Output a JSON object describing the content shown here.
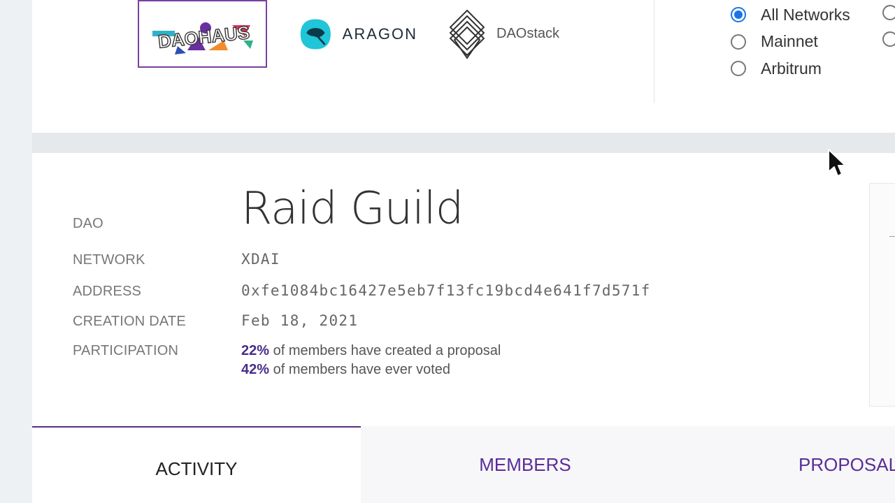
{
  "platforms": [
    {
      "name": "daohaus",
      "label": "DAOHAUS",
      "selected": true
    },
    {
      "name": "aragon",
      "label": "ARAGON",
      "selected": false
    },
    {
      "name": "daostack",
      "label": "DAOstack",
      "selected": false
    }
  ],
  "networks": {
    "options": [
      {
        "label": "All Networks",
        "checked": true
      },
      {
        "label": "Mainnet",
        "checked": false
      },
      {
        "label": "Arbitrum",
        "checked": false
      }
    ]
  },
  "dao": {
    "labels": {
      "dao": "DAO",
      "network": "NETWORK",
      "address": "ADDRESS",
      "creation_date": "CREATION DATE",
      "participation": "PARTICIPATION"
    },
    "name": "Raid Guild",
    "network": "XDAI",
    "address": "0xfe1084bc16427e5eb7f13fc19bcd4e641f7d571f",
    "creation_date": "Feb 18, 2021",
    "participation": {
      "proposal_pct": "22%",
      "proposal_text": "of members have created a proposal",
      "voted_pct": "42%",
      "voted_text": "of members have ever voted"
    }
  },
  "tabs": [
    {
      "label": "ACTIVITY",
      "active": true
    },
    {
      "label": "MEMBERS",
      "active": false
    },
    {
      "label": "PROPOSALS",
      "active": false
    }
  ],
  "colors": {
    "accent": "#5a2d82",
    "radio_checked": "#1a73e8",
    "percent": "#4a2b8c"
  }
}
